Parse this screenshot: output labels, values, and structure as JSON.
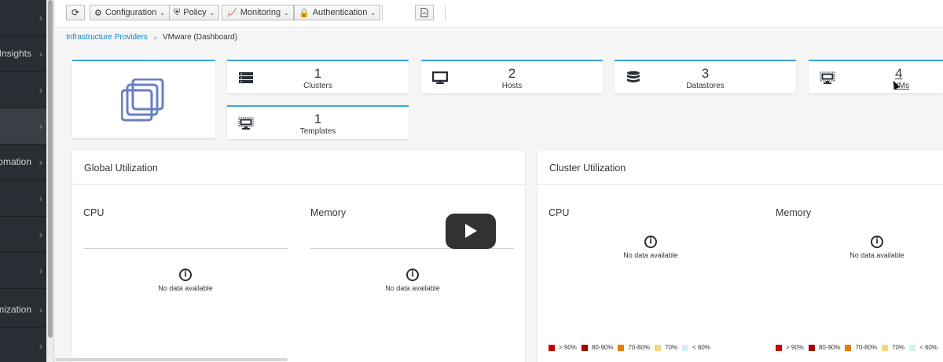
{
  "sidebar": {
    "items": [
      {
        "label": ""
      },
      {
        "label": "Insights"
      },
      {
        "label": ""
      },
      {
        "label": ""
      },
      {
        "label": "Automation"
      },
      {
        "label": ""
      },
      {
        "label": ""
      },
      {
        "label": ""
      },
      {
        "label": "Optimization"
      },
      {
        "label": ""
      }
    ],
    "active_index": 3
  },
  "toolbar": {
    "reload_icon": "refresh-icon",
    "configuration_label": "Configuration",
    "policy_label": "Policy",
    "monitoring_label": "Monitoring",
    "authentication_label": "Authentication",
    "pdf_icon": "pdf-icon"
  },
  "breadcrumb": {
    "parent": "Infrastructure Providers",
    "separator": "»",
    "current": "VMware (Dashboard)"
  },
  "cards": [
    {
      "count": "1",
      "label": "Clusters",
      "icon": "cluster-icon"
    },
    {
      "count": "2",
      "label": "Hosts",
      "icon": "host-icon"
    },
    {
      "count": "3",
      "label": "Datastores",
      "icon": "datastore-icon"
    },
    {
      "count": "4",
      "label": "VMs",
      "icon": "vm-icon"
    },
    {
      "count": "1",
      "label": "Templates",
      "icon": "template-icon"
    }
  ],
  "global_util": {
    "title": "Global Utilization",
    "cpu_label": "CPU",
    "memory_label": "Memory",
    "cpu_nodata": "No data available",
    "memory_nodata": "No data available"
  },
  "cluster_util": {
    "title": "Cluster Utilization",
    "cpu_label": "CPU",
    "memory_label": "Memory",
    "cpu_nodata": "No data available",
    "memory_nodata": "No data available"
  },
  "legend": [
    {
      "label": "> 90%",
      "color": "#cc0000"
    },
    {
      "label": "80-90%",
      "color": "#a30000"
    },
    {
      "label": "70-80%",
      "color": "#ec7a08"
    },
    {
      "label": "70%",
      "color": "#f9d67a"
    },
    {
      "label": "< 60%",
      "color": "#d1f1f0"
    }
  ]
}
